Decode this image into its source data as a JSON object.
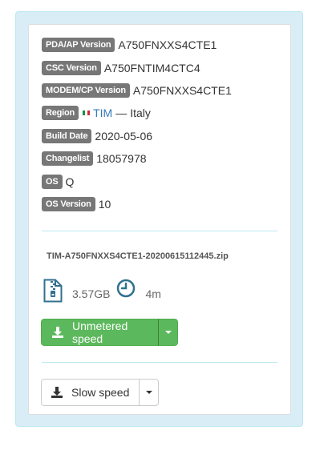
{
  "firmware": {
    "fields": [
      {
        "label": "PDA/AP Version",
        "value": "A750FNXXS4CTE1"
      },
      {
        "label": "CSC Version",
        "value": "A750FNTIM4CTC4"
      },
      {
        "label": "MODEM/CP Version",
        "value": "A750FNXXS4CTE1"
      },
      {
        "label": "Region",
        "carrier": "TIM",
        "separator": "—",
        "country": "Italy"
      },
      {
        "label": "Build Date",
        "value": "2020-05-06"
      },
      {
        "label": "Changelist",
        "value": "18057978"
      },
      {
        "label": "OS",
        "value": "Q"
      },
      {
        "label": "OS Version",
        "value": "10"
      }
    ]
  },
  "download": {
    "filename": "TIM-A750FNXXS4CTE1-20200615112445.zip",
    "size": "3.57GB",
    "time": "4m",
    "size_icon": "zip-file-icon",
    "time_icon": "clock-icon",
    "unmetered_label": "Unmetered speed",
    "slow_label": "Slow speed"
  },
  "colors": {
    "panel_bg": "#d9edf7",
    "badge": "#777777",
    "success": "#5cb85c",
    "link": "#337ab7",
    "icon_blue": "#31708f"
  }
}
